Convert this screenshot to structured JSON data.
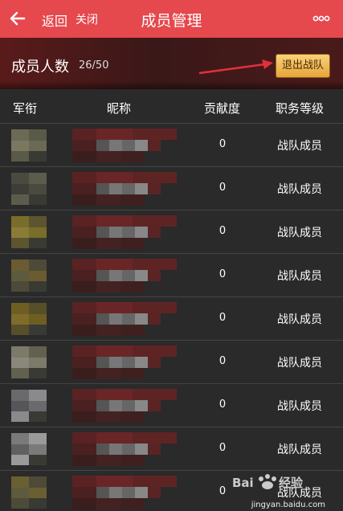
{
  "header": {
    "back_label": "返回",
    "close_label": "关闭",
    "title": "成员管理",
    "back_icon": "back-arrow-icon",
    "more_icon": "more-dots-icon"
  },
  "banner": {
    "count_label": "成员人数",
    "count_value": "26/50",
    "quit_button_label": "退出战队"
  },
  "table": {
    "headers": {
      "rank": "军衔",
      "nickname": "昵称",
      "contribution": "贡献度",
      "role": "职务等级"
    },
    "rows": [
      {
        "contribution": "0",
        "role": "战队成员"
      },
      {
        "contribution": "0",
        "role": "战队成员"
      },
      {
        "contribution": "0",
        "role": "战队成员"
      },
      {
        "contribution": "0",
        "role": "战队成员"
      },
      {
        "contribution": "0",
        "role": "战队成员"
      },
      {
        "contribution": "0",
        "role": "战队成员"
      },
      {
        "contribution": "0",
        "role": "战队成员"
      },
      {
        "contribution": "0",
        "role": "战队成员"
      },
      {
        "contribution": "0",
        "role": "战队成员"
      }
    ]
  },
  "watermark": {
    "text": "jingyan.baidu.com"
  },
  "colors": {
    "topbar": "#e5484d",
    "button_gold": "#e6a43a",
    "arrow_red": "#e0303a",
    "background": "#2a2a2a"
  }
}
